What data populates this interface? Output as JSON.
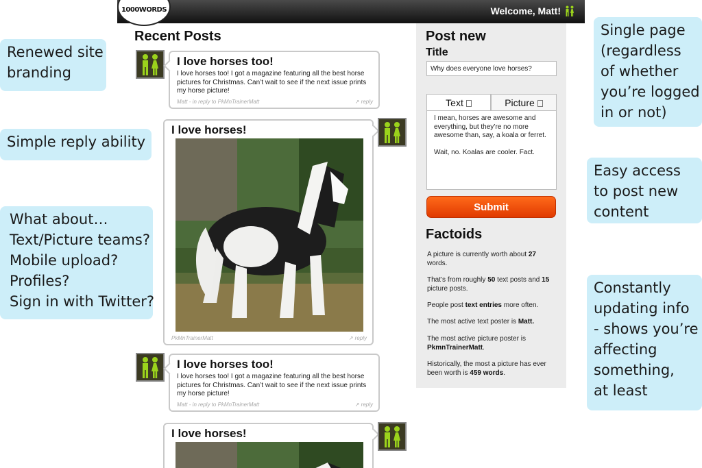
{
  "annotations": [
    {
      "id": "renewed-branding",
      "lines": [
        "Renewed site",
        "branding"
      ]
    },
    {
      "id": "simple-reply",
      "lines": [
        "Simple reply ability"
      ]
    },
    {
      "id": "what-about",
      "lines": [
        "What about…",
        "Text/Picture teams?",
        "Mobile upload?",
        "Profiles?",
        "Sign in with Twitter?"
      ]
    },
    {
      "id": "single-page",
      "lines": [
        "Single page",
        "(regardless",
        "of whether",
        "you’re logged",
        "in or not)"
      ]
    },
    {
      "id": "easy-access",
      "lines": [
        "Easy access",
        "to post new",
        "content"
      ]
    },
    {
      "id": "constantly-updating",
      "lines": [
        "Constantly",
        "updating info",
        "- shows you’re",
        "affecting",
        "something,",
        "at least"
      ]
    }
  ],
  "header": {
    "logo_text": "1000WORDS",
    "welcome": "Welcome, Matt!",
    "user_icon": "people-icon"
  },
  "feed": {
    "title": "Recent Posts",
    "posts": [
      {
        "title": "I love horses too!",
        "body": "I love horses too! I got a magazine featuring all the best horse pictures for Christmas. Can’t wait to see if the next issue prints my horse picture!",
        "meta": "Matt - in reply to PkMnTrainerMatt",
        "reply": "reply"
      },
      {
        "title": "I love horses!",
        "image": "horse-photo",
        "meta": "PkMnTrainerMatt",
        "reply": "reply"
      },
      {
        "title": "I love horses too!",
        "body": "I love horses too! I got a magazine featuring all the best horse pictures for Christmas. Can’t wait to see if the next issue prints my horse picture!",
        "meta": "Matt - in reply to PkMnTrainerMatt",
        "reply": "reply"
      },
      {
        "title": "I love horses!",
        "image": "horse-photo"
      }
    ]
  },
  "post_new": {
    "heading": "Post new",
    "title_label": "Title",
    "title_value": "Why does everyone love horses?",
    "tabs": [
      {
        "label": "Text",
        "icon": "document-icon",
        "active": true
      },
      {
        "label": "Picture",
        "icon": "picture-icon",
        "active": false
      }
    ],
    "body_p1": "I mean, horses are awesome and everything, but they’re no more awesome than, say, a koala or ferret.",
    "body_p2": "Wait, no. Koalas are cooler. Fact.",
    "submit_label": "Submit"
  },
  "factoids": {
    "heading": "Factoids",
    "items": [
      {
        "pre": "A picture is currently worth about ",
        "b1": "27",
        "mid": " words.",
        "b2": "",
        "post": ""
      },
      {
        "pre": "That’s from roughly ",
        "b1": "50",
        "mid": " text posts and ",
        "b2": "15",
        "post": " picture posts."
      },
      {
        "pre": "People post ",
        "b1": "text entries",
        "mid": " more often.",
        "b2": "",
        "post": ""
      },
      {
        "pre": "The most active text poster is ",
        "b1": "Matt.",
        "mid": "",
        "b2": "",
        "post": ""
      },
      {
        "pre": "The most active picture poster is ",
        "b1": "PkmnTrainerMatt",
        "mid": ".",
        "b2": "",
        "post": ""
      },
      {
        "pre": "Historically, the most a picture has ever been worth is ",
        "b1": "459 words",
        "mid": ".",
        "b2": "",
        "post": ""
      }
    ]
  },
  "colors": {
    "accent": "#ff5a10",
    "icon_green": "#9bd31c",
    "avatar_bg": "#3b3a22",
    "callout_bg": "#cdeef9"
  }
}
